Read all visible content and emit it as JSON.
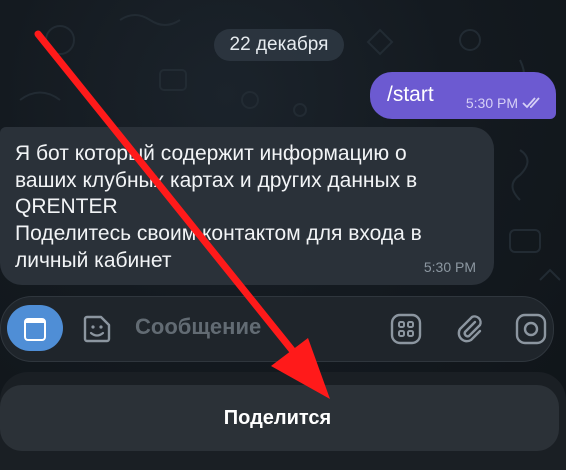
{
  "chat": {
    "date_label": "22 декабря",
    "outgoing": {
      "text": "/start",
      "time": "5:30 PM",
      "status_icon": "double-check-icon"
    },
    "incoming": {
      "lines": [
        "Я бот который содержит информацию о",
        "ваших клубных картах и других данных в",
        "QRENTER",
        "Поделитесь своим контактом для входа в",
        "личный кабинет"
      ],
      "time": "5:30 PM"
    }
  },
  "composer": {
    "placeholder": "Сообщение",
    "icons": [
      "menu-icon",
      "sticker-icon",
      "apps-grid-icon",
      "attach-icon",
      "camera-icon"
    ]
  },
  "keyboard": {
    "share_label": "Поделится"
  },
  "colors": {
    "outgoing_bubble": "#6c5ad1",
    "incoming_bubble": "#2a3139",
    "menu_button": "#4f8ed6",
    "annotation_arrow": "#ff1a1a"
  }
}
